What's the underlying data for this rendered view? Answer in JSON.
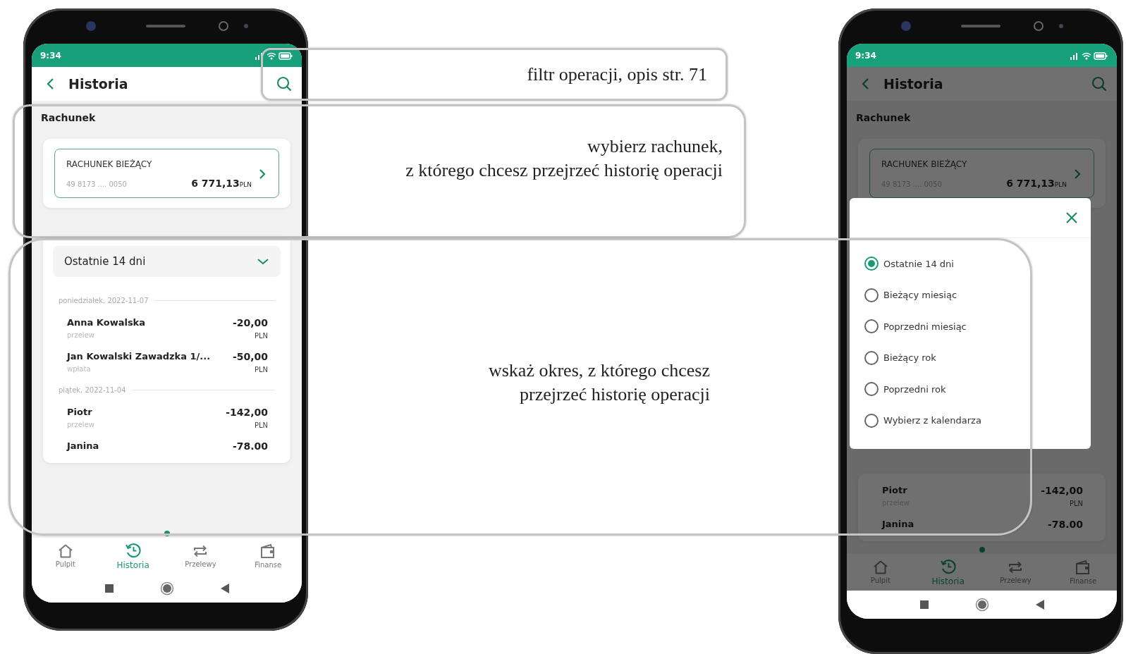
{
  "phones": [
    {
      "status_time": "9:34",
      "dimmed": false,
      "header": {
        "title": "Historia"
      },
      "account_section": {
        "label": "Rachunek",
        "account_name": "RACHUNEK BIEŻĄCY",
        "account_number": "49 8173 .... 0050",
        "balance": "6 771,13",
        "currency": "PLN"
      },
      "period_select": {
        "value": "Ostatnie 14 dni"
      },
      "groups": [
        {
          "date": "poniedziałek, 2022-11-07",
          "transactions": [
            {
              "name": "Anna Kowalska",
              "type": "przelew",
              "amount": "-20,00",
              "currency": "PLN"
            },
            {
              "name": "Jan Kowalski Zawadzka 1/...",
              "type": "wpłata",
              "amount": "-50,00",
              "currency": "PLN"
            }
          ]
        },
        {
          "date": "piątek, 2022-11-04",
          "transactions": [
            {
              "name": "Piotr",
              "type": "przelew",
              "amount": "-142,00",
              "currency": "PLN"
            },
            {
              "name": "Janina",
              "amount": "-78.00"
            }
          ]
        }
      ],
      "nav": [
        {
          "label": "Pulpit",
          "selected": false
        },
        {
          "label": "Historia",
          "selected": true
        },
        {
          "label": "Przelewy",
          "selected": false
        },
        {
          "label": "Finanse",
          "selected": false
        }
      ]
    },
    {
      "status_time": "9:34",
      "dimmed": true,
      "header": {
        "title": "Historia"
      },
      "account_section": {
        "label": "Rachunek",
        "account_name": "RACHUNEK BIEŻĄCY",
        "account_number": "49 8173 .... 0050",
        "balance": "6 771,13",
        "currency": "PLN"
      },
      "groups": [
        {
          "transactions": [
            {
              "name": "Piotr",
              "type": "przelew",
              "amount": "-142,00",
              "currency": "PLN"
            },
            {
              "name": "Janina",
              "amount": "-78.00"
            }
          ]
        }
      ],
      "modal": {
        "options": [
          {
            "label": "Ostatnie 14 dni",
            "selected": true
          },
          {
            "label": "Bieżący miesiąc",
            "selected": false
          },
          {
            "label": "Poprzedni miesiąc",
            "selected": false
          },
          {
            "label": "Bieżący rok",
            "selected": false
          },
          {
            "label": "Poprzedni rok",
            "selected": false
          },
          {
            "label": "Wybierz z kalendarza",
            "selected": false
          }
        ]
      },
      "nav": [
        {
          "label": "Pulpit",
          "selected": false
        },
        {
          "label": "Historia",
          "selected": true
        },
        {
          "label": "Przelewy",
          "selected": false
        },
        {
          "label": "Finanse",
          "selected": false
        }
      ]
    }
  ],
  "annotations": [
    {
      "text": "filtr operacji, opis str. 71"
    },
    {
      "text": "wybierz rachunek,\nz którego chcesz przejrzeć historię operacji"
    },
    {
      "text": "wskaż okres, z którego chcesz\nprzejrzeć historię operacji"
    }
  ]
}
